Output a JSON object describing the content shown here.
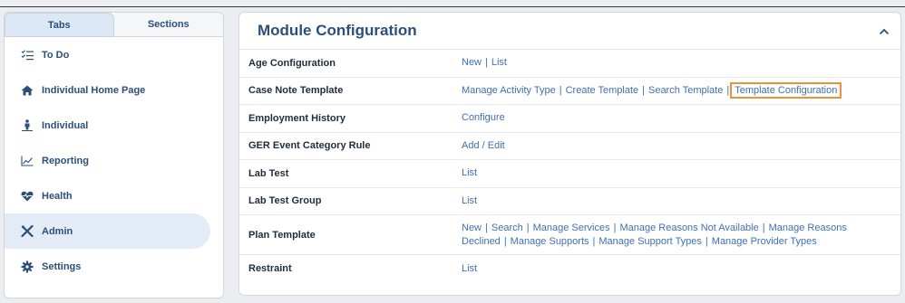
{
  "sidebar": {
    "tabs": [
      {
        "label": "Tabs"
      },
      {
        "label": "Sections"
      }
    ],
    "items": [
      {
        "label": "To Do",
        "icon": "todo-list-icon"
      },
      {
        "label": "Individual Home Page",
        "icon": "home-icon"
      },
      {
        "label": "Individual",
        "icon": "person-icon"
      },
      {
        "label": "Reporting",
        "icon": "chart-icon"
      },
      {
        "label": "Health",
        "icon": "heartbeat-icon"
      },
      {
        "label": "Admin",
        "icon": "tools-icon"
      },
      {
        "label": "Settings",
        "icon": "gear-icon"
      }
    ]
  },
  "main": {
    "title": "Module Configuration",
    "rows": [
      {
        "label": "Age Configuration",
        "links": [
          "New",
          "List"
        ]
      },
      {
        "label": "Case Note Template",
        "links": [
          "Manage Activity Type",
          "Create Template",
          "Search Template",
          "Template Configuration"
        ]
      },
      {
        "label": "Employment History",
        "links": [
          "Configure"
        ]
      },
      {
        "label": "GER Event Category Rule",
        "links": [
          "Add / Edit"
        ]
      },
      {
        "label": "Lab Test",
        "links": [
          "List"
        ]
      },
      {
        "label": "Lab Test Group",
        "links": [
          "List"
        ]
      },
      {
        "label": "Plan Template",
        "links": [
          "New",
          "Search",
          "Manage Services",
          "Manage Reasons Not Available",
          "Manage Reasons Declined",
          "Manage Supports",
          "Manage Support Types",
          "Manage Provider Types"
        ]
      },
      {
        "label": "Restraint",
        "links": [
          "List"
        ]
      }
    ]
  },
  "colors": {
    "link": "#3f6fb4",
    "accent": "#2b4f7a",
    "highlight": "#f0913a"
  }
}
